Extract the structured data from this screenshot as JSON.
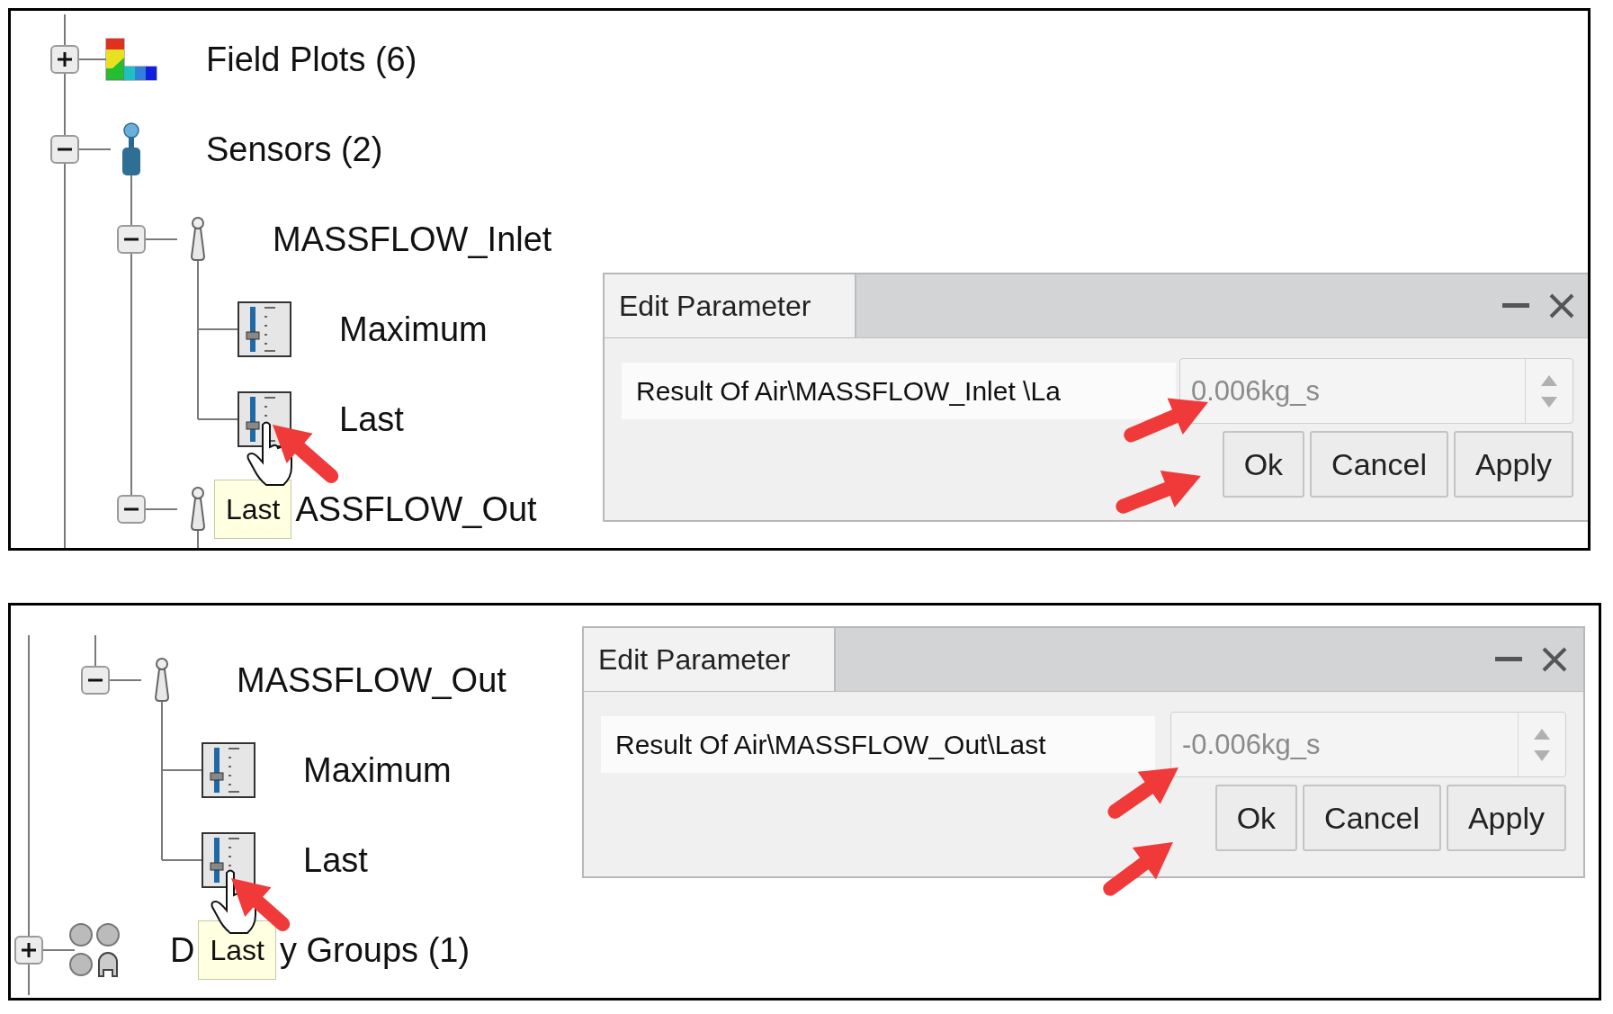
{
  "panels": [
    {
      "tree": [
        {
          "kind": "field-plot",
          "label": "Field Plots (6)",
          "expanded": false
        },
        {
          "kind": "sensor-group",
          "label": "Sensors (2)",
          "expanded": true,
          "children": [
            {
              "kind": "sensor",
              "label": "MASSFLOW_Inlet",
              "expanded": true,
              "children": [
                {
                  "kind": "result",
                  "label": "Maximum"
                },
                {
                  "kind": "result",
                  "label": "Last"
                }
              ]
            },
            {
              "kind": "sensor",
              "tooltip": "Last",
              "label_after": "ASSFLOW_Out",
              "expanded": true
            }
          ]
        }
      ],
      "dialog": {
        "title": "Edit Parameter",
        "label": "Result Of Air\\MASSFLOW_Inlet \\La",
        "value": "0.006kg_s",
        "disabled": true,
        "buttons": [
          "Ok",
          "Cancel",
          "Apply"
        ]
      }
    },
    {
      "tree": [
        {
          "expanded": true,
          "children": [
            {
              "kind": "sensor",
              "label": "MASSFLOW_Out",
              "expanded": true,
              "children": [
                {
                  "kind": "result",
                  "label": "Maximum"
                },
                {
                  "kind": "result",
                  "label": "Last"
                }
              ]
            }
          ]
        },
        {
          "kind": "display-group",
          "label": "D",
          "tooltip": "Last",
          "label_after": "y Groups (1)",
          "expanded": false
        }
      ],
      "dialog": {
        "title": "Edit Parameter",
        "label": "Result Of Air\\MASSFLOW_Out\\Last",
        "value": "-0.006kg_s",
        "disabled": true,
        "buttons": [
          "Ok",
          "Cancel",
          "Apply"
        ]
      }
    }
  ]
}
